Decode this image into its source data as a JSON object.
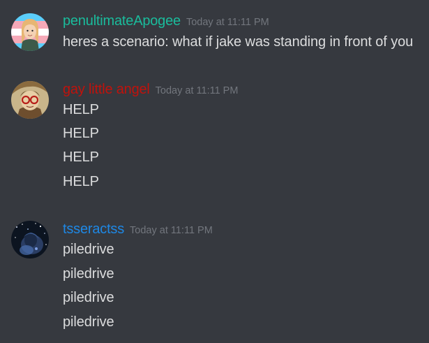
{
  "colors": {
    "background": "#36393f",
    "message_text": "#dcddde",
    "timestamp": "#72767d"
  },
  "messages": [
    {
      "username": "penultimateApogee",
      "username_color": "#1abc9c",
      "avatar_icon": "avatar-trans-flag-portrait-icon",
      "timestamp": "Today at 11:11 PM",
      "lines": [
        "heres a scenario: what if jake was standing in front of you"
      ]
    },
    {
      "username": "gay little angel",
      "username_color": "#c0120c",
      "avatar_icon": "avatar-red-glasses-portrait-icon",
      "timestamp": "Today at 11:11 PM",
      "lines": [
        "HELP",
        "HELP",
        "HELP",
        "HELP"
      ]
    },
    {
      "username": "tsseractss",
      "username_color": "#1e88e5",
      "avatar_icon": "avatar-starry-night-portrait-icon",
      "timestamp": "Today at 11:11 PM",
      "lines": [
        "piledrive",
        "piledrive",
        "piledrive",
        "piledrive"
      ]
    }
  ]
}
